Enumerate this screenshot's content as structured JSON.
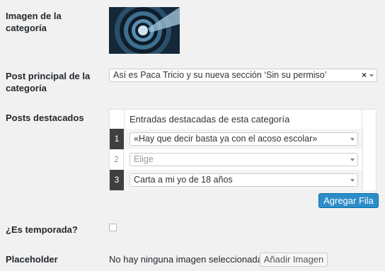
{
  "fields": {
    "image_label": "Imagen de la categoría",
    "main_post_label": "Post principal de la categoría",
    "featured_label": "Posts destacados",
    "season_label": "¿Es temporada?",
    "placeholder_label": "Placeholder"
  },
  "main_post": {
    "value": "Así es Paca Tricio y su nueva sección ‘Sin su permiso’",
    "clear": "×"
  },
  "featured": {
    "header": "Entradas destacadas de esta categoría",
    "rows": [
      {
        "num": "1",
        "value": "«Hay que decir basta ya con el acoso escolar»"
      },
      {
        "num": "2",
        "value": "Elige"
      },
      {
        "num": "3",
        "value": "Carta a mi yo de 18 años"
      }
    ],
    "add_button": "Agregar Fila"
  },
  "placeholder": {
    "status": "No hay ninguna imagen seleccionada",
    "add_button": "Añadir Imagen"
  },
  "colors": {
    "primary": "#2e8dc9",
    "row_num_dark": "#3f3f3f"
  }
}
